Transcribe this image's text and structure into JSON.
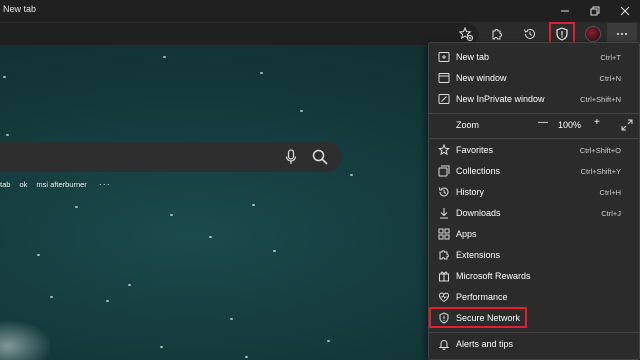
{
  "window": {
    "tab_title": "New tab"
  },
  "toolbar": {
    "icons": [
      "favorites-star-icon",
      "extensions-icon",
      "history-icon",
      "secure-network-shield-icon",
      "profile-avatar",
      "more-menu-icon"
    ]
  },
  "new_tab_page": {
    "quick_links": [
      "tab",
      "ok",
      "msi afterburner"
    ],
    "quick_links_more": "···"
  },
  "menu": {
    "items": [
      {
        "label": "New tab",
        "shortcut": "Ctrl+T",
        "icon": "new-tab-icon"
      },
      {
        "label": "New window",
        "shortcut": "Ctrl+N",
        "icon": "new-window-icon"
      },
      {
        "label": "New InPrivate window",
        "shortcut": "Ctrl+Shift+N",
        "icon": "inprivate-icon"
      },
      {
        "label": "Zoom",
        "value": "100%",
        "icon": ""
      },
      {
        "label": "Favorites",
        "shortcut": "Ctrl+Shift+O",
        "icon": "favorites-icon"
      },
      {
        "label": "Collections",
        "shortcut": "Ctrl+Shift+Y",
        "icon": "collections-icon"
      },
      {
        "label": "History",
        "shortcut": "Ctrl+H",
        "icon": "history-icon"
      },
      {
        "label": "Downloads",
        "shortcut": "Ctrl+J",
        "icon": "downloads-icon"
      },
      {
        "label": "Apps",
        "shortcut": "",
        "icon": "apps-icon"
      },
      {
        "label": "Extensions",
        "shortcut": "",
        "icon": "extensions-icon"
      },
      {
        "label": "Microsoft Rewards",
        "shortcut": "",
        "icon": "rewards-icon"
      },
      {
        "label": "Performance",
        "shortcut": "",
        "icon": "performance-icon"
      },
      {
        "label": "Secure Network",
        "shortcut": "",
        "icon": "secure-network-icon"
      },
      {
        "label": "Alerts and tips",
        "shortcut": "",
        "icon": "alerts-icon"
      }
    ],
    "zoom_minus": "—",
    "zoom_plus": "+"
  },
  "colors": {
    "highlight": "#e0202b",
    "menu_bg": "#2b2b2b",
    "ocean": "#143a3c"
  }
}
